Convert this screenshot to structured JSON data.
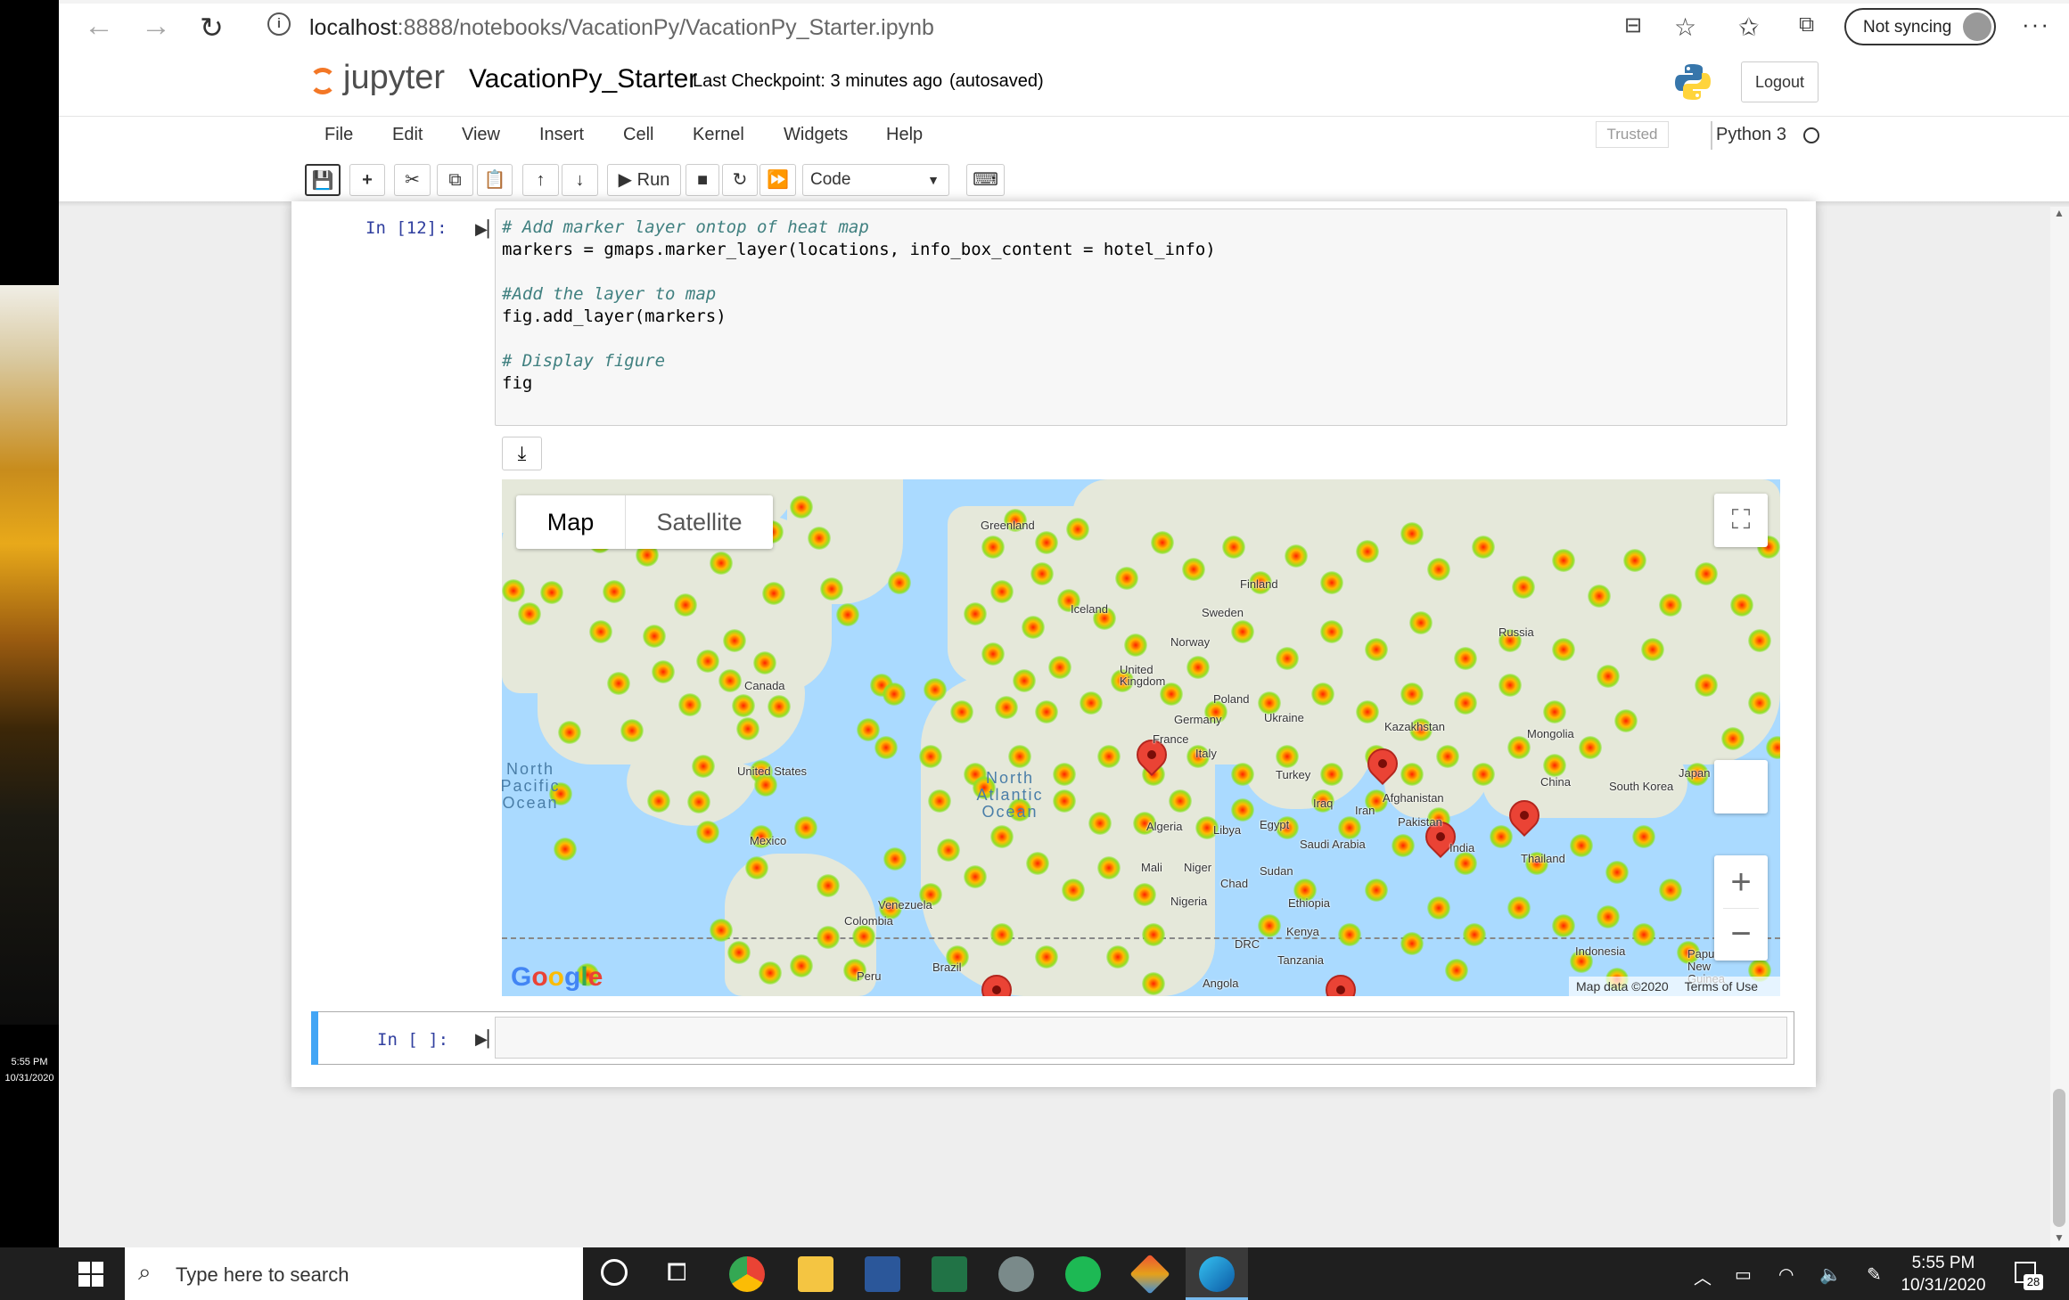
{
  "desktop": {
    "time": "5:55 PM",
    "date": "10/31/2020"
  },
  "browser": {
    "url_host": "localhost",
    "url_path": ":8888/notebooks/VacationPy/VacationPy_Starter.ipynb",
    "sync_label": "Not syncing"
  },
  "jupyter": {
    "logo_text": "jupyter",
    "notebook_name": "VacationPy_Starter",
    "checkpoint": "Last Checkpoint: 3 minutes ago",
    "autosaved": "(autosaved)",
    "logout": "Logout",
    "menu": [
      "File",
      "Edit",
      "View",
      "Insert",
      "Cell",
      "Kernel",
      "Widgets",
      "Help"
    ],
    "trusted": "Trusted",
    "kernel": "Python 3",
    "toolbar": {
      "run_label": "Run",
      "cell_type": "Code"
    }
  },
  "cells": [
    {
      "prompt": "In [12]:",
      "lines": [
        {
          "type": "comment",
          "text": "# Add marker layer ontop of heat map"
        },
        {
          "type": "code",
          "text": "markers = gmaps.marker_layer(locations, info_box_content = hotel_info)"
        },
        {
          "type": "blank",
          "text": ""
        },
        {
          "type": "comment",
          "text": "#Add the layer to map"
        },
        {
          "type": "code",
          "text": "fig.add_layer(markers)"
        },
        {
          "type": "blank",
          "text": ""
        },
        {
          "type": "comment",
          "text": "# Display figure"
        },
        {
          "type": "code",
          "text": "fig"
        }
      ]
    },
    {
      "prompt": "In [ ]:",
      "lines": []
    }
  ],
  "map": {
    "tab_map": "Map",
    "tab_satellite": "Satellite",
    "google": "Google",
    "map_data": "Map data ©2020",
    "terms": "Terms of Use",
    "zoom_in": "+",
    "zoom_out": "−",
    "labels": {
      "greenland": "Greenland",
      "iceland": "Iceland",
      "finland": "Finland",
      "sweden": "Sweden",
      "norway": "Norway",
      "united_kingdom": "United Kingdom",
      "poland": "Poland",
      "germany": "Germany",
      "ukraine": "Ukraine",
      "france": "France",
      "italy": "Italy",
      "russia": "Russia",
      "kazakhstan": "Kazakhstan",
      "mongolia": "Mongolia",
      "china": "China",
      "south_korea": "South Korea",
      "japan": "Japan",
      "turkey": "Turkey",
      "iraq": "Iraq",
      "iran": "Iran",
      "afghanistan": "Afghanistan",
      "pakistan": "Pakistan",
      "india": "India",
      "thailand": "Thailand",
      "algeria": "Algeria",
      "libya": "Libya",
      "egypt": "Egypt",
      "saudi_arabia": "Saudi Arabia",
      "mali": "Mali",
      "niger": "Niger",
      "chad": "Chad",
      "sudan": "Sudan",
      "nigeria": "Nigeria",
      "ethiopia": "Ethiopia",
      "kenya": "Kenya",
      "drc": "DRC",
      "tanzania": "Tanzania",
      "angola": "Angola",
      "canada": "Canada",
      "united_states": "United States",
      "mexico": "Mexico",
      "venezuela": "Venezuela",
      "colombia": "Colombia",
      "peru": "Peru",
      "brazil": "Brazil",
      "indonesia": "Indonesia",
      "papua": "Papua New Guinea",
      "north_pacific": "North Pacific Ocean",
      "north_atlantic": "North Atlantic Ocean"
    }
  },
  "taskbar": {
    "search_placeholder": "Type here to search",
    "time": "5:55 PM",
    "date": "10/31/2020",
    "notifications": "28"
  }
}
